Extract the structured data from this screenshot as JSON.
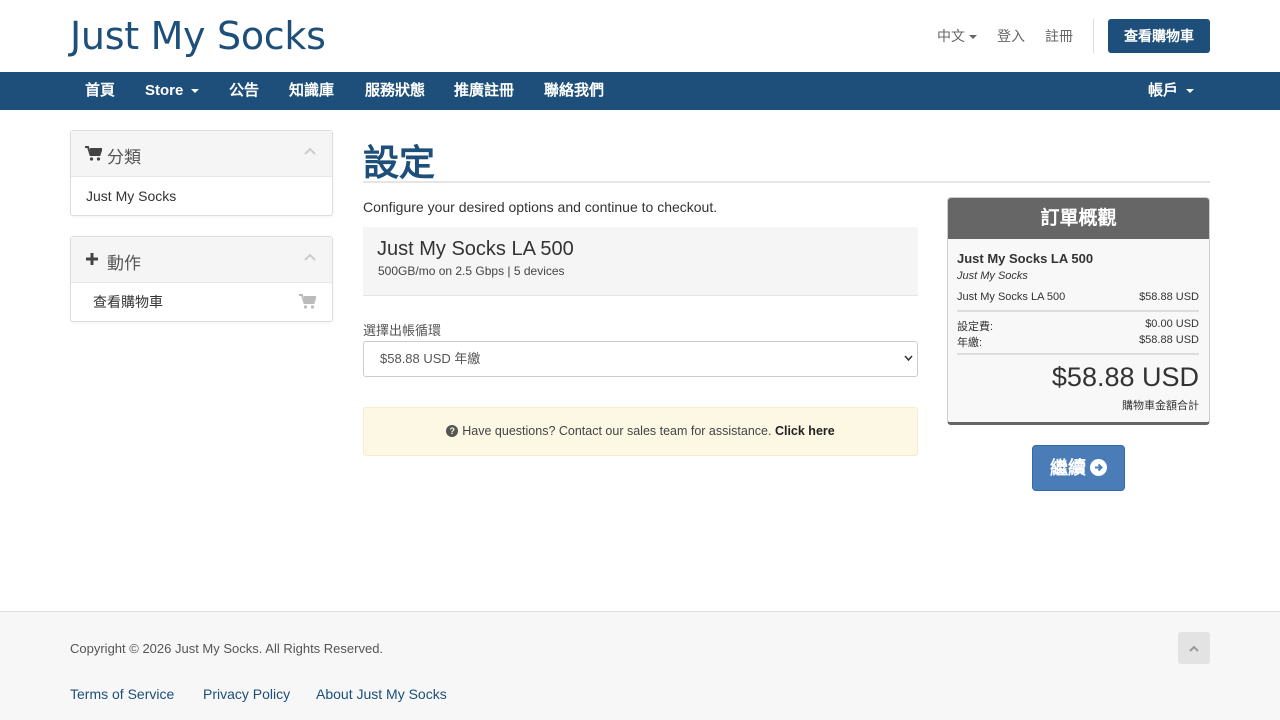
{
  "header": {
    "logo": "Just My Socks",
    "language": "中文",
    "login": "登入",
    "register": "註冊",
    "view_cart": "查看購物車"
  },
  "nav": {
    "items": [
      "首頁",
      "Store",
      "公告",
      "知識庫",
      "服務狀態",
      "推廣註冊",
      "聯絡我們"
    ],
    "account": "帳戶"
  },
  "sidebar": {
    "categories_title": "分類",
    "categories": [
      "Just My Socks"
    ],
    "actions_title": "動作",
    "actions": [
      "查看購物車"
    ]
  },
  "main": {
    "title": "設定",
    "intro": "Configure your desired options and continue to checkout.",
    "product_name": "Just My Socks LA 500",
    "product_desc": "500GB/mo on 2.5 Gbps | 5 devices",
    "cycle_label": "選擇出帳循環",
    "cycle_selected": "$58.88 USD 年繳",
    "notice_text": "Have questions? Contact our sales team for assistance.",
    "notice_link": "Click here"
  },
  "summary": {
    "title": "訂單概觀",
    "product": "Just My Socks LA 500",
    "group": "Just My Socks",
    "line_label": "Just My Socks LA 500",
    "line_price": "$58.88 USD",
    "setup_label": "設定費:",
    "setup_price": "$0.00 USD",
    "annual_label": "年繳:",
    "annual_price": "$58.88 USD",
    "total": "$58.88 USD",
    "total_label": "購物車金額合計",
    "continue": "繼續"
  },
  "footer": {
    "copyright": "Copyright © 2026 Just My Socks. All Rights Reserved.",
    "links": [
      "Terms of Service",
      "Privacy Policy",
      "About Just My Socks"
    ]
  },
  "colors": {
    "brand": "#1d4f7a",
    "continue_button": "#4a7db8",
    "summary_header": "#666666",
    "notice_bg": "#fcf8e3"
  }
}
